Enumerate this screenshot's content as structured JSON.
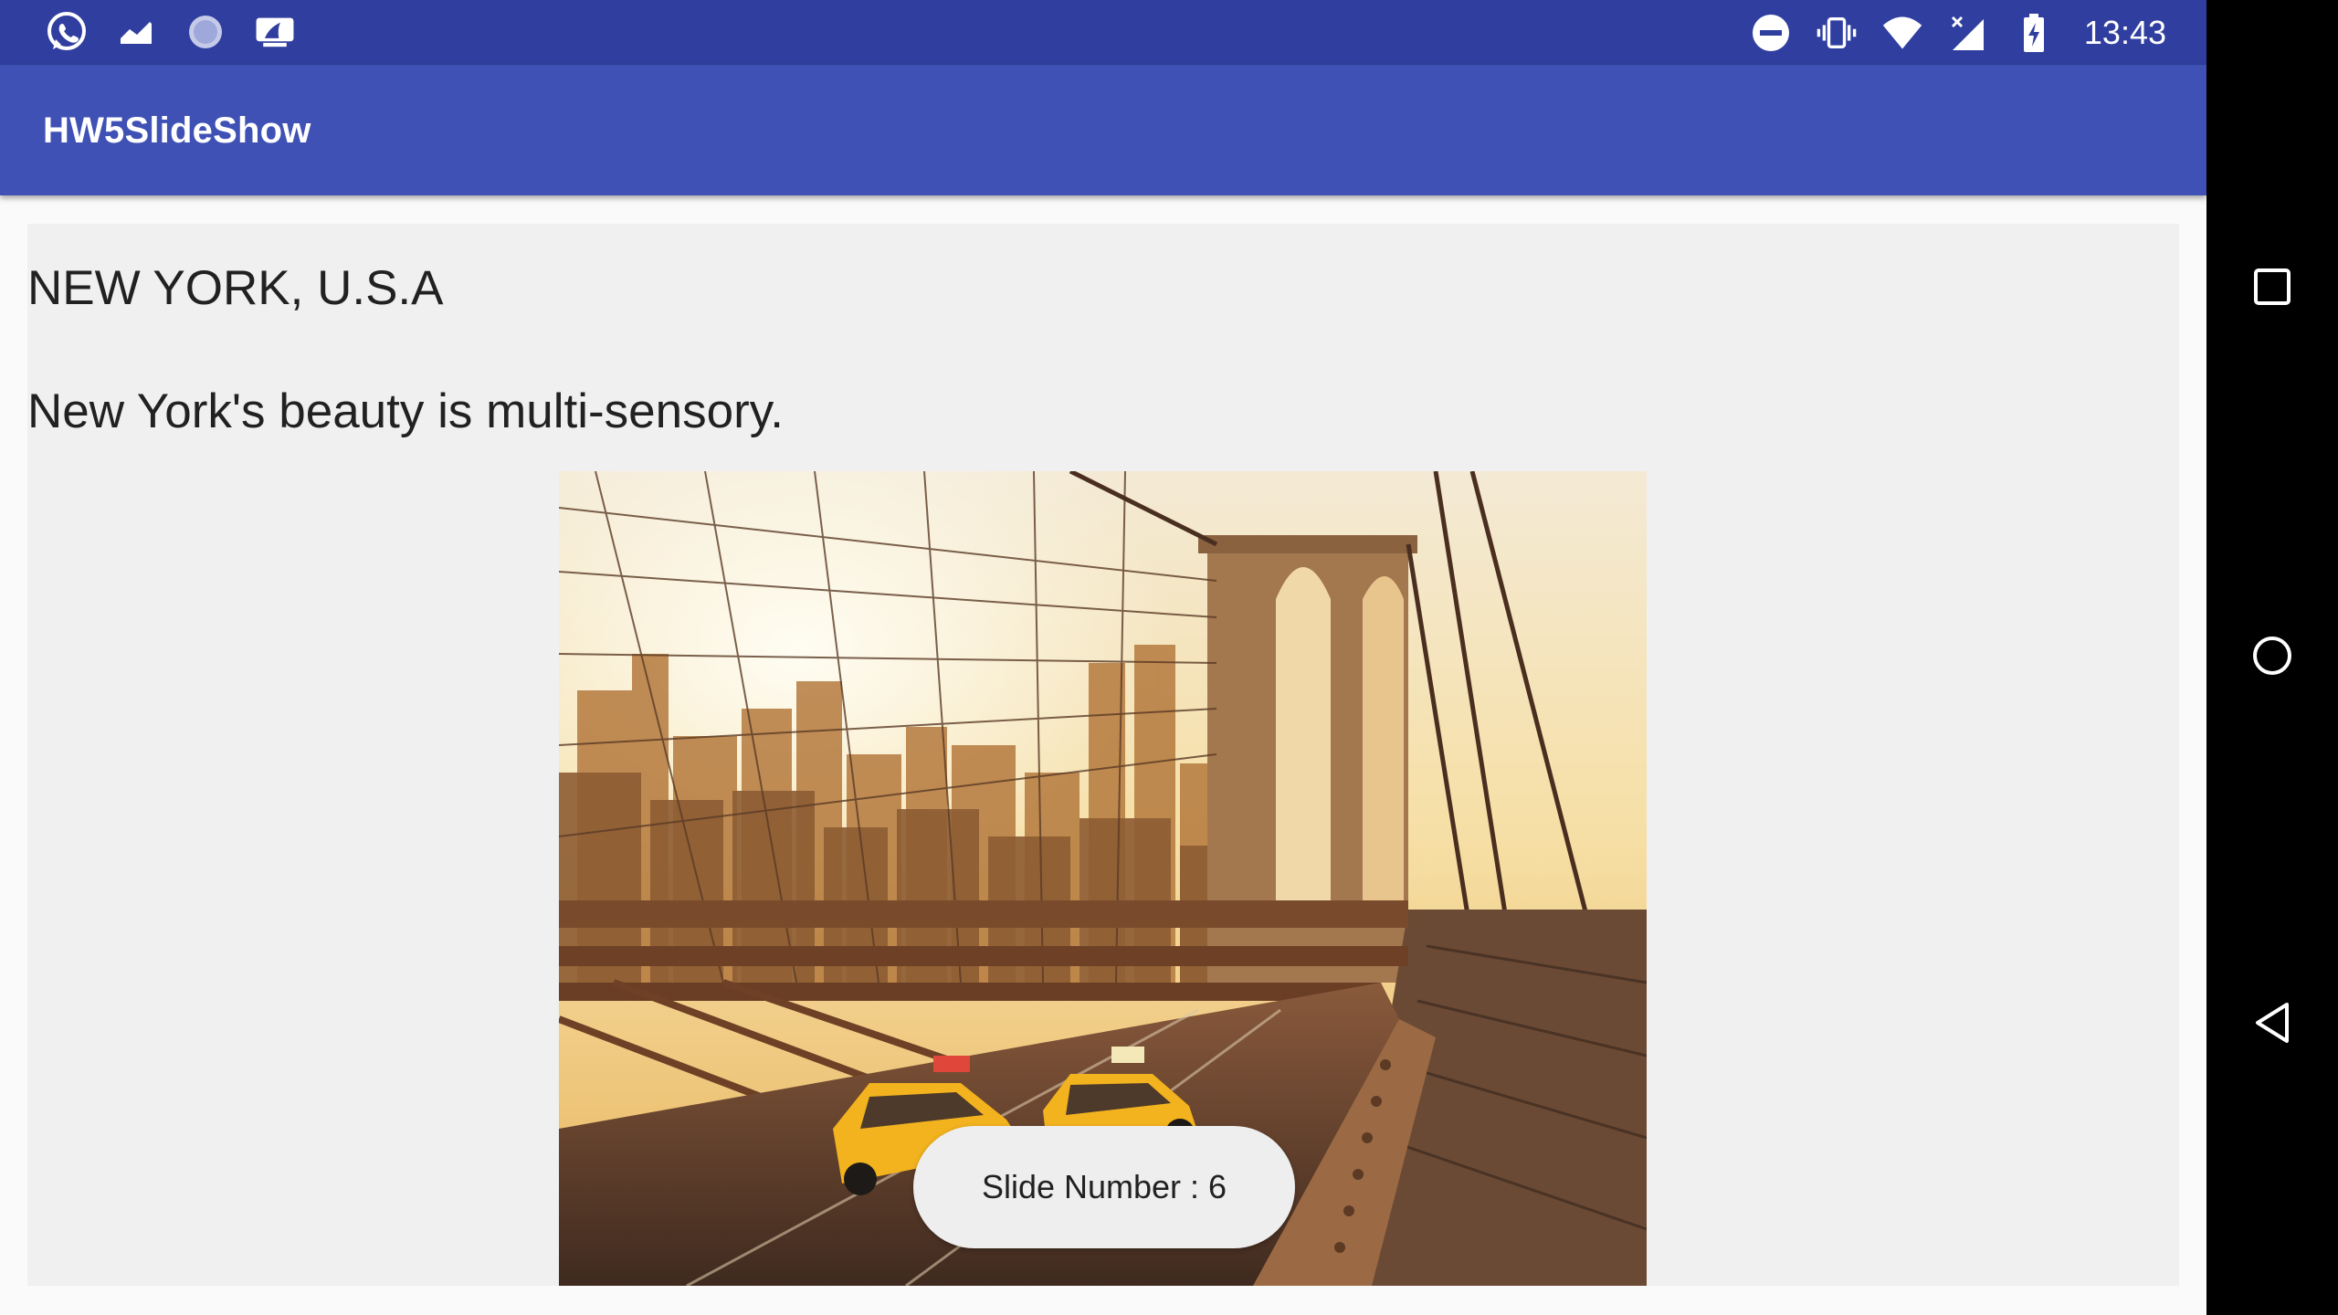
{
  "status_bar": {
    "left_icons": [
      "whatsapp-icon",
      "stocks-icon",
      "loading-icon",
      "mlb-icon"
    ],
    "right_icons": [
      "do-not-disturb-icon",
      "vibrate-icon",
      "wifi-icon",
      "cell-signal-icon",
      "battery-charging-icon"
    ],
    "time": "13:43"
  },
  "app_bar": {
    "title": "HW5SlideShow"
  },
  "slide": {
    "title": "NEW YORK, U.S.A",
    "description": "New York's beauty is multi-sensory.",
    "image_subject": "Brooklyn Bridge with yellow taxis at sunset"
  },
  "toast": {
    "text": "Slide Number : 6"
  },
  "nav_bar": {
    "buttons": [
      "recents-icon",
      "home-icon",
      "back-icon"
    ]
  },
  "colors": {
    "status_bar": "#303f9f",
    "app_bar": "#3f51b5",
    "content_bg": "#f0f0f0",
    "nav_bar": "#000000"
  }
}
